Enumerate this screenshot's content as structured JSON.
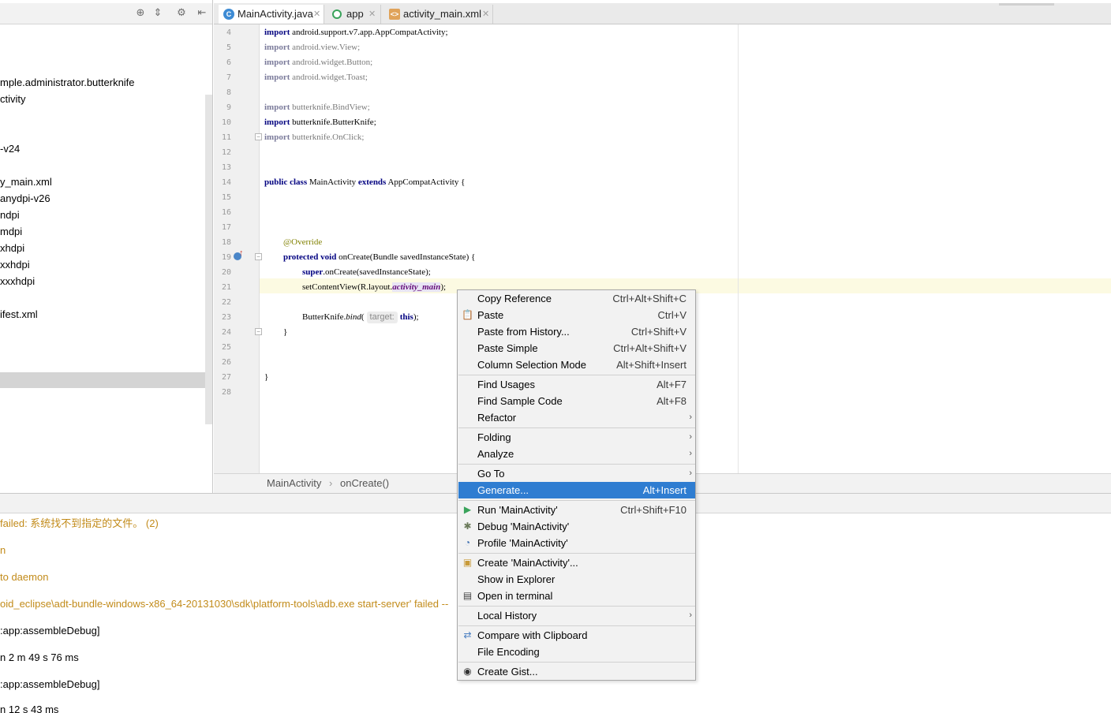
{
  "project_tree": {
    "items": [
      "mple.administrator.butterknife",
      "ctivity",
      "-v24",
      "y_main.xml",
      "anydpi-v26",
      "ndpi",
      "mdpi",
      "xhdpi",
      "xxhdpi",
      "xxxhdpi",
      "ifest.xml"
    ]
  },
  "tabs": [
    {
      "label": "MainActivity.java",
      "icon": "java-class-icon",
      "active": true
    },
    {
      "label": "app",
      "icon": "gradle-module-icon",
      "active": false
    },
    {
      "label": "activity_main.xml",
      "icon": "layout-xml-icon",
      "active": false
    }
  ],
  "editor": {
    "line_numbers": [
      "4",
      "5",
      "6",
      "7",
      "8",
      "9",
      "10",
      "11",
      "12",
      "13",
      "14",
      "15",
      "16",
      "17",
      "18",
      "19",
      "20",
      "21",
      "22",
      "23",
      "24",
      "25",
      "26",
      "27",
      "28"
    ],
    "lines": {
      "l4_kw": "import",
      "l4_rest": " android.support.v7.app.AppCompatActivity;",
      "l5_kw": "import",
      "l5_rest": " android.view.View;",
      "l6_kw": "import",
      "l6_rest": " android.widget.Button;",
      "l7_kw": "import",
      "l7_rest": " android.widget.Toast;",
      "l9_kw": "import",
      "l9_rest": " butterknife.BindView;",
      "l10_kw": "import",
      "l10_rest": " butterknife.ButterKnife;",
      "l11_kw": "import",
      "l11_rest": " butterknife.OnClick;",
      "l14_kw1": "public",
      "l14_kw2": "class",
      "l14_mid": " MainActivity ",
      "l14_kw3": "extends",
      "l14_rest": " AppCompatActivity {",
      "l18_ann": "@Override",
      "l19_kw1": "protected",
      "l19_kw2": "void",
      "l19_rest": " onCreate(Bundle savedInstanceState) {",
      "l20_kw": "super",
      "l20_rest": ".onCreate(savedInstanceState);",
      "l21_pre": "setContentView(R.layout.",
      "l21_fld": "activity_main",
      "l21_post": ");",
      "l23_pre": "ButterKnife.",
      "l23_mtd": "bind",
      "l23_open": "(",
      "l23_hint": "target:",
      "l23_kw": "this",
      "l23_post": ");",
      "l24": "}",
      "l27": "}"
    }
  },
  "breadcrumb": {
    "class": "MainActivity",
    "sep": "›",
    "method": "onCreate()"
  },
  "build_log": [
    {
      "text": "failed: 系统找不到指定的文件。 (2)",
      "kind": "warn"
    },
    {
      "text": "n",
      "kind": "warn"
    },
    {
      "text": "to daemon",
      "kind": "warn"
    },
    {
      "text": "oid_eclipse\\adt-bundle-windows-x86_64-20131030\\sdk\\platform-tools\\adb.exe start-server' failed --",
      "kind": "warn"
    },
    {
      "text": ":app:assembleDebug]",
      "kind": "info"
    },
    {
      "text": "n 2 m 49 s 76 ms",
      "kind": "info"
    },
    {
      "text": ":app:assembleDebug]",
      "kind": "info"
    },
    {
      "text": "n 12 s 43 ms",
      "kind": "info"
    }
  ],
  "context_menu": {
    "items": [
      {
        "label": "Copy Reference",
        "shortcut": "Ctrl+Alt+Shift+C"
      },
      {
        "label": "Paste",
        "shortcut": "Ctrl+V",
        "icon": "clipboard-icon"
      },
      {
        "label": "Paste from History...",
        "shortcut": "Ctrl+Shift+V"
      },
      {
        "label": "Paste Simple",
        "shortcut": "Ctrl+Alt+Shift+V"
      },
      {
        "label": "Column Selection Mode",
        "shortcut": "Alt+Shift+Insert"
      },
      {
        "label": "Find Usages",
        "shortcut": "Alt+F7"
      },
      {
        "label": "Find Sample Code",
        "shortcut": "Alt+F8"
      },
      {
        "label": "Refactor",
        "submenu": true
      },
      {
        "label": "Folding",
        "submenu": true
      },
      {
        "label": "Analyze",
        "submenu": true
      },
      {
        "label": "Go To",
        "submenu": true
      },
      {
        "label": "Generate...",
        "shortcut": "Alt+Insert",
        "selected": true
      },
      {
        "label": "Run 'MainActivity'",
        "shortcut": "Ctrl+Shift+F10",
        "icon": "run-icon"
      },
      {
        "label": "Debug 'MainActivity'",
        "icon": "debug-icon"
      },
      {
        "label": "Profile 'MainActivity'",
        "icon": "profile-icon"
      },
      {
        "label": "Create 'MainActivity'...",
        "icon": "create-config-icon"
      },
      {
        "label": "Show in Explorer"
      },
      {
        "label": "Open in terminal",
        "icon": "terminal-icon"
      },
      {
        "label": "Local History",
        "submenu": true
      },
      {
        "label": "Compare with Clipboard",
        "icon": "compare-icon"
      },
      {
        "label": "File Encoding"
      },
      {
        "label": "Create Gist...",
        "icon": "github-icon"
      }
    ],
    "submenu_arrow": "›"
  },
  "colors": {
    "keyword": "#000080",
    "field": "#660e7a",
    "annotation": "#808000",
    "menu_selection": "#2f7dd1",
    "log_warning": "#c28b1a"
  }
}
